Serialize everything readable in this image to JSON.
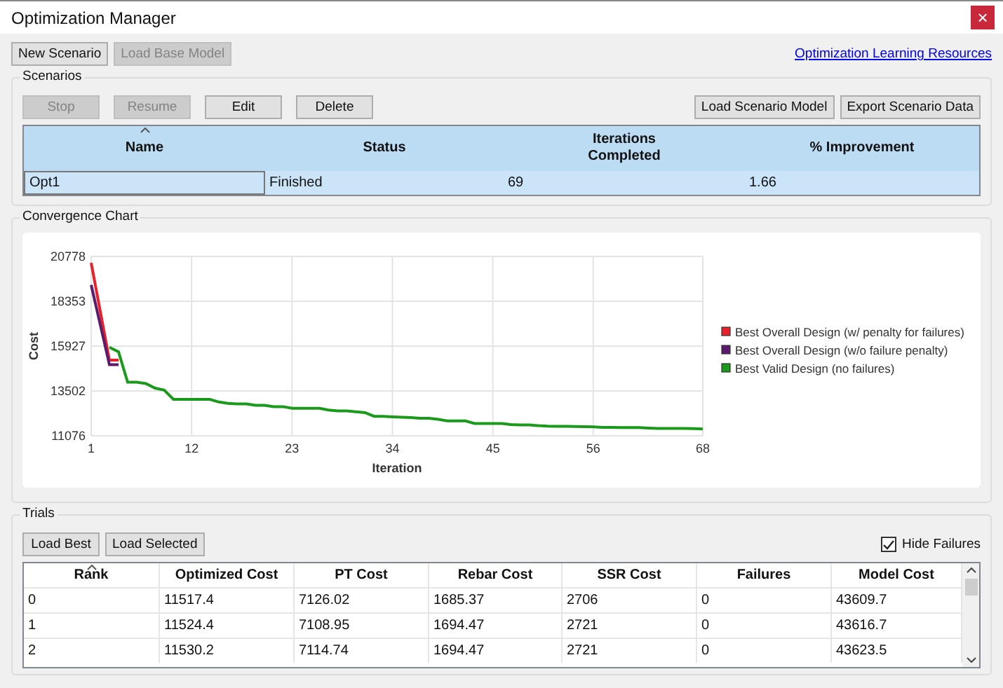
{
  "window": {
    "title": "Optimization Manager",
    "close": "×"
  },
  "toolbar": {
    "buttons": [
      {
        "label": "New Scenario",
        "disabled": false
      },
      {
        "label": "Load Base Model",
        "disabled": true
      }
    ],
    "link": "Optimization Learning Resources"
  },
  "scenarios": {
    "title": "Scenarios",
    "left_buttons": [
      {
        "label": "Stop",
        "disabled": true
      },
      {
        "label": "Resume",
        "disabled": true
      },
      {
        "label": "Edit",
        "disabled": false
      },
      {
        "label": "Delete",
        "disabled": false
      }
    ],
    "right_buttons": [
      {
        "label": "Load Scenario Model",
        "disabled": false
      },
      {
        "label": "Export Scenario Data",
        "disabled": false
      }
    ],
    "columns": [
      "Name",
      "Status",
      "Iterations\nCompleted",
      "% Improvement"
    ],
    "rows": [
      {
        "selected": true,
        "cells": [
          "Opt1",
          "Finished",
          "69",
          "1.66"
        ]
      }
    ]
  },
  "convergence": {
    "title": "Convergence Chart",
    "chart_data": {
      "type": "line",
      "xlabel": "Iteration",
      "ylabel": "Cost",
      "x": [
        1,
        2,
        3,
        4,
        5,
        6,
        7,
        8,
        9,
        10,
        11,
        12,
        13,
        14,
        15,
        16,
        17,
        18,
        19,
        20,
        21,
        22,
        23,
        24,
        25,
        26,
        27,
        28,
        29,
        30,
        31,
        32,
        33,
        34,
        35,
        36,
        37,
        38,
        39,
        40,
        41,
        42,
        43,
        44,
        45,
        46,
        47,
        48,
        49,
        50,
        51,
        52,
        53,
        54,
        55,
        56,
        57,
        58,
        59,
        60,
        61,
        62,
        63,
        64,
        65,
        66,
        67,
        68
      ],
      "grid": true,
      "legend": "right",
      "xlim": [
        1,
        68
      ],
      "ylim": [
        11076,
        20778
      ],
      "xticks": [
        1,
        12,
        23,
        34,
        45,
        56,
        68
      ],
      "yticks": [
        11076,
        13502,
        15927,
        18353,
        20778
      ],
      "series": [
        {
          "name": "Best Overall Design (w/ penalty for failures)",
          "color": "#e8202a",
          "values": [
            20430,
            17800,
            15170,
            15170,
            null,
            null,
            null,
            null,
            null,
            null,
            null,
            null,
            null,
            null,
            null,
            null,
            null,
            null,
            null,
            null,
            null,
            null,
            null,
            null,
            null,
            null,
            null,
            null,
            null,
            null,
            null,
            null,
            null,
            null,
            null,
            null,
            null,
            null,
            null,
            null,
            null,
            null,
            null,
            null,
            null,
            null,
            null,
            null,
            null,
            null,
            null,
            null,
            null,
            null,
            null,
            null,
            null,
            null,
            null,
            null,
            null,
            null,
            null,
            null,
            null,
            null,
            null,
            null
          ]
        },
        {
          "name": "Best Overall Design (w/o failure penalty)",
          "color": "#5c1a6e",
          "values": [
            19230,
            17080,
            14930,
            14930,
            null,
            null,
            null,
            null,
            null,
            null,
            null,
            null,
            null,
            null,
            null,
            null,
            null,
            null,
            null,
            null,
            null,
            null,
            null,
            null,
            null,
            null,
            null,
            null,
            null,
            null,
            null,
            null,
            null,
            null,
            null,
            null,
            null,
            null,
            null,
            null,
            null,
            null,
            null,
            null,
            null,
            null,
            null,
            null,
            null,
            null,
            null,
            null,
            null,
            null,
            null,
            null,
            null,
            null,
            null,
            null,
            null,
            null,
            null,
            null,
            null,
            null,
            null,
            null
          ]
        },
        {
          "name": "Best Valid Design (no failures)",
          "color": "#1a9a1a",
          "values": [
            null,
            null,
            15860,
            15620,
            13970,
            13970,
            13900,
            13650,
            13550,
            13050,
            13050,
            13050,
            13050,
            13050,
            12900,
            12830,
            12800,
            12800,
            12720,
            12720,
            12650,
            12650,
            12560,
            12560,
            12560,
            12560,
            12470,
            12420,
            12420,
            12370,
            12330,
            12130,
            12130,
            12100,
            12080,
            12060,
            12020,
            12020,
            11960,
            11880,
            11880,
            11880,
            11740,
            11740,
            11740,
            11740,
            11680,
            11660,
            11660,
            11620,
            11600,
            11590,
            11590,
            11580,
            11570,
            11560,
            11530,
            11530,
            11520,
            11520,
            11520,
            11490,
            11470,
            11470,
            11470,
            11470,
            11460,
            11450
          ]
        }
      ]
    }
  },
  "trials": {
    "title": "Trials",
    "buttons": [
      {
        "label": "Load Best",
        "disabled": false
      },
      {
        "label": "Load Selected",
        "disabled": false
      }
    ],
    "hide_failures": {
      "label": "Hide Failures",
      "checked": true
    },
    "columns": [
      "Rank",
      "Optimized Cost",
      "PT Cost",
      "Rebar Cost",
      "SSR Cost",
      "Failures",
      "Model Cost"
    ],
    "rows": [
      {
        "selected": false,
        "cells": [
          "0",
          "11517.4",
          "7126.02",
          "1685.37",
          "2706",
          "0",
          "43609.7"
        ]
      },
      {
        "selected": false,
        "cells": [
          "1",
          "11524.4",
          "7108.95",
          "1694.47",
          "2721",
          "0",
          "43616.7"
        ]
      },
      {
        "selected": false,
        "cells": [
          "2",
          "11530.2",
          "7114.74",
          "1694.47",
          "2721",
          "0",
          "43623.5"
        ]
      }
    ]
  }
}
